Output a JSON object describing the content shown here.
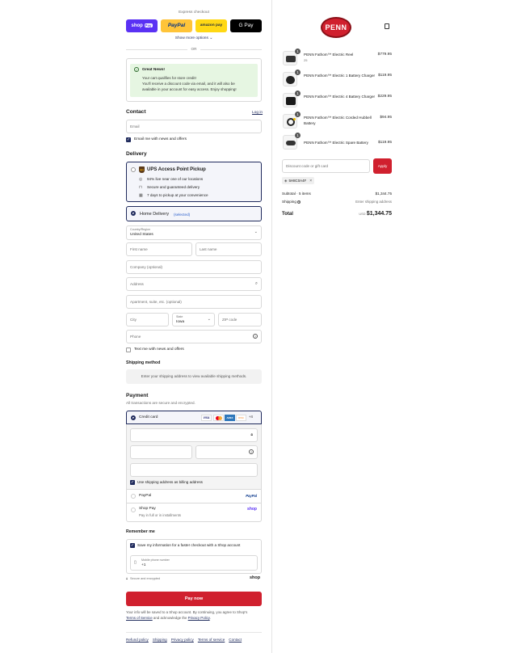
{
  "express": {
    "title": "Express checkout",
    "shop_pay": "shop",
    "shop_pay_suffix": "Pay",
    "paypal": "PayPal",
    "amazon": "amazon pay",
    "gpay": "G Pay",
    "show_more": "Show more options",
    "or": "OR"
  },
  "notice": {
    "title": "Great News!",
    "line1": "Your cart qualifies for store credit!",
    "line2": "You'll receive a discount code via email, and it will also be",
    "line3": "available in your account for easy access. Enjoy shopping!"
  },
  "contact": {
    "heading": "Contact",
    "login": "Log in",
    "email_placeholder": "Email",
    "email_news": "Email me with news and offers"
  },
  "delivery": {
    "heading": "Delivery",
    "ups_title": "UPS Access Point Pickup",
    "ups_badge": "ups",
    "ups_points": [
      "94% live near one of our locations",
      "Secure and guaranteed delivery",
      "7 days to pickup at your convenience"
    ],
    "home_label": "Home Delivery",
    "home_selected": "(selected)",
    "country_label": "Country/Region",
    "country_value": "United States",
    "first_name": "First name",
    "last_name": "Last name",
    "company": "Company (optional)",
    "address": "Address",
    "apartment": "Apartment, suite, etc. (optional)",
    "city": "City",
    "state_label": "State",
    "state_value": "Iowa",
    "zip": "ZIP code",
    "phone": "Phone",
    "text_news": "Text me with news and offers"
  },
  "shipping": {
    "heading": "Shipping method",
    "placeholder": "Enter your shipping address to view available shipping methods."
  },
  "payment": {
    "heading": "Payment",
    "sub": "All transactions are secure and encrypted.",
    "credit_card": "Credit card",
    "cards": [
      "VISA",
      "MC",
      "AMEX",
      "DISC",
      "+4"
    ],
    "use_shipping": "Use shipping address as billing address",
    "paypal": "PayPal",
    "paypal_logo": "PayPal",
    "shoppay": "Shop Pay",
    "shoppay_sub": "Pay in full or in installments",
    "shoppay_logo": "shop"
  },
  "remember": {
    "heading": "Remember me",
    "save_info": "Save my information for a faster checkout with a Shop account",
    "mobile_label": "Mobile phone number",
    "mobile_value": "+1",
    "secure": "Secure and encrypted",
    "shop_logo": "shop"
  },
  "pay_now": "Pay now",
  "footer_note": {
    "line1": "Your info will be saved to a Shop account. By continuing, you agree to Shop's",
    "tos": "Terms of Service",
    "and": " and acknowledge the ",
    "privacy": "Privacy Policy"
  },
  "footer_links": [
    "Refund policy",
    "Shipping",
    "Privacy policy",
    "Terms of service",
    "Contact"
  ],
  "brand": {
    "logo": "PENN",
    "color": "#d0202e"
  },
  "order": {
    "items": [
      {
        "qty": "1",
        "name": "PENN Fathom™ Electric Reel",
        "sub": "25",
        "price": "$779.95"
      },
      {
        "qty": "1",
        "name": "PENN Fathom™ Electric 1 Battery Charger",
        "sub": "",
        "price": "$119.95"
      },
      {
        "qty": "1",
        "name": "PENN Fathom™ Electric 4 Battery Charger",
        "sub": "",
        "price": "$229.95"
      },
      {
        "qty": "1",
        "name": "PENN Fathom™ Electric Corded Hubbell Battery",
        "sub": "",
        "price": "$94.95"
      },
      {
        "qty": "1",
        "name": "PENN Fathom™ Electric Spare Battery",
        "sub": "",
        "price": "$119.95"
      }
    ],
    "discount_placeholder": "Discount code or gift card",
    "apply": "Apply",
    "applied_code": "5H8C0A4F",
    "subtotal_label": "Subtotal · 5 items",
    "subtotal_value": "$1,344.75",
    "shipping_label": "Shipping",
    "shipping_value": "Enter shipping address",
    "total_label": "Total",
    "total_currency": "USD",
    "total_value": "$1,344.75"
  }
}
